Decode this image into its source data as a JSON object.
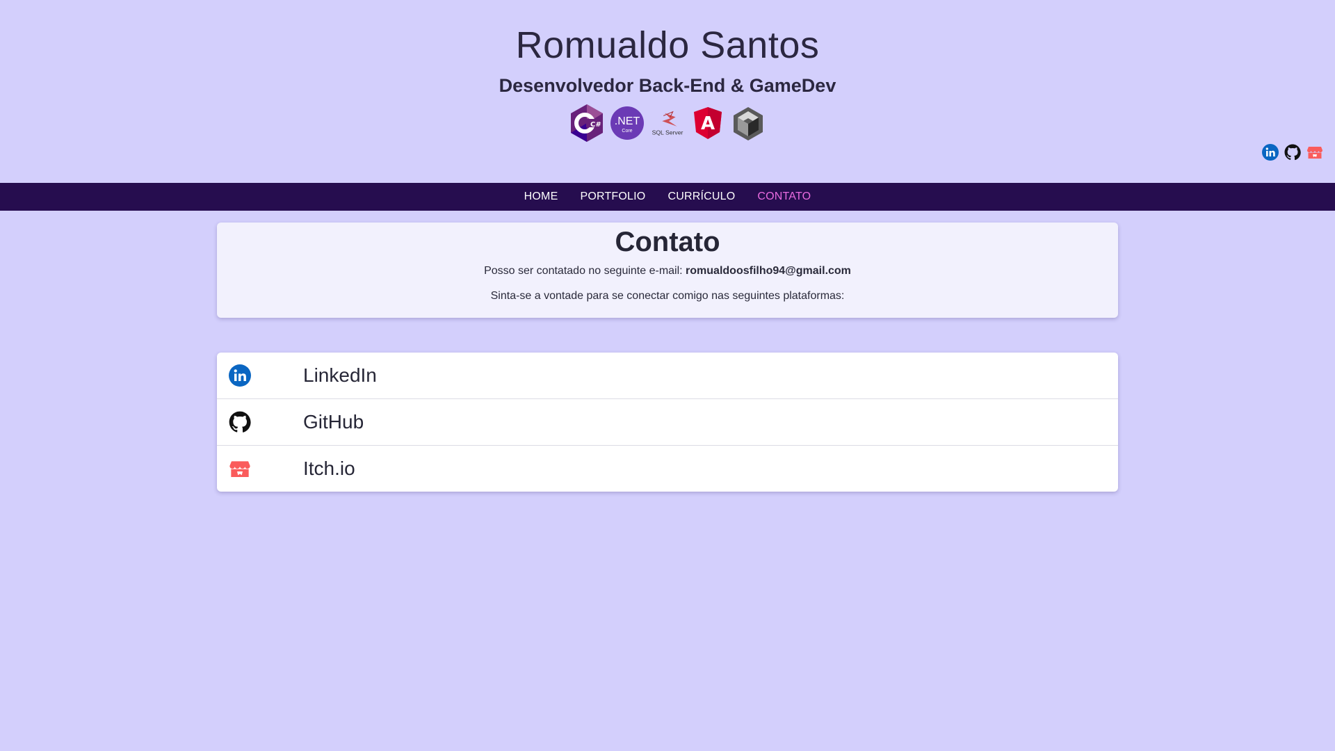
{
  "header": {
    "title": "Romualdo Santos",
    "subtitle": "Desenvolvedor Back-End & GameDev",
    "tech_icons": [
      {
        "name": "csharp-icon",
        "text": "C#"
      },
      {
        "name": "dotnet-core-icon",
        "text": ".NET",
        "subtext": "Core"
      },
      {
        "name": "sql-server-icon",
        "text": "SQL Server"
      },
      {
        "name": "angular-icon",
        "text": "A"
      },
      {
        "name": "unity-icon",
        "text": ""
      }
    ],
    "social": [
      "linkedin-icon",
      "github-icon",
      "itchio-icon"
    ]
  },
  "nav": {
    "items": [
      {
        "label": "HOME"
      },
      {
        "label": "PORTFOLIO"
      },
      {
        "label": "CURRÍCULO"
      },
      {
        "label": "CONTATO",
        "active": true
      }
    ]
  },
  "contact": {
    "title": "Contato",
    "email_prefix": "Posso ser contatado no seguinte e-mail:",
    "email": "romualdoosfilho94@gmail.com",
    "platforms_text": "Sinta-se a vontade para se conectar comigo nas seguintes plataformas:"
  },
  "platforms": [
    {
      "label": "LinkedIn",
      "icon": "linkedin-icon"
    },
    {
      "label": "GitHub",
      "icon": "github-icon"
    },
    {
      "label": "Itch.io",
      "icon": "itchio-icon"
    }
  ],
  "colors": {
    "background": "#d3cffc",
    "navbar": "#260d4f",
    "nav_active": "#e96be0",
    "linkedin": "#0a66c2",
    "itchio": "#fa5c5c"
  }
}
